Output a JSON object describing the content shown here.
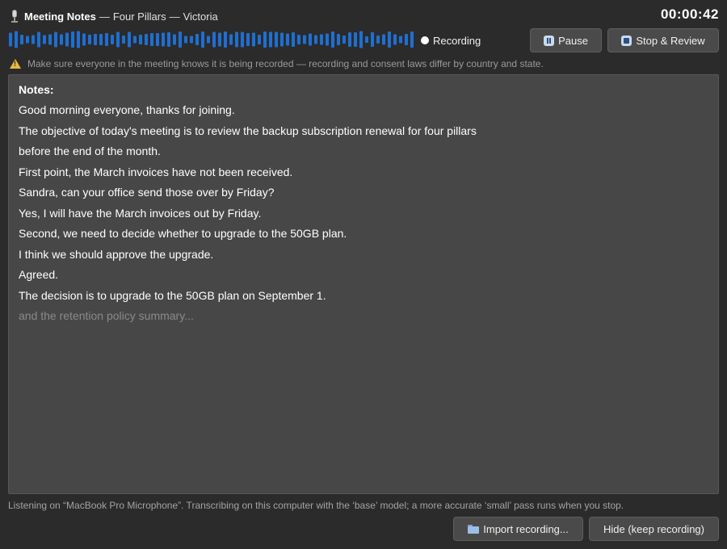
{
  "header": {
    "app_name": "Meeting Notes",
    "separator": "—",
    "meeting_name": "Four Pillars",
    "person": "Victoria",
    "timer": "00:00:42"
  },
  "recording": {
    "status": "Recording",
    "waveform_color": "#1f6fd1"
  },
  "controls": {
    "pause_label": "Pause",
    "stop_label": "Stop & Review"
  },
  "warning": {
    "text": "Make sure everyone in the meeting knows it is being recorded — recording and consent laws differ by country and state."
  },
  "notes": {
    "label": "Notes:",
    "lines": [
      "Good morning everyone, thanks for joining.",
      "The objective of today's meeting is to review the backup subscription renewal for four pillars",
      "before the end of the month.",
      "First point, the March invoices have not been received.",
      "Sandra, can your office send those over by Friday?",
      "Yes, I will have the March invoices out by Friday.",
      "Second, we need to decide whether to upgrade to the 50GB plan.",
      "I think we should approve the upgrade.",
      "Agreed.",
      "The decision is to upgrade to the 50GB plan on September 1."
    ],
    "pending": "and the retention policy summary..."
  },
  "footer": {
    "info": "Listening on “MacBook Pro Microphone”. Transcribing on this computer with the ‘base’ model; a more accurate ‘small’ pass runs when you stop.",
    "import_label": "Import recording...",
    "hide_label": "Hide (keep recording)"
  }
}
